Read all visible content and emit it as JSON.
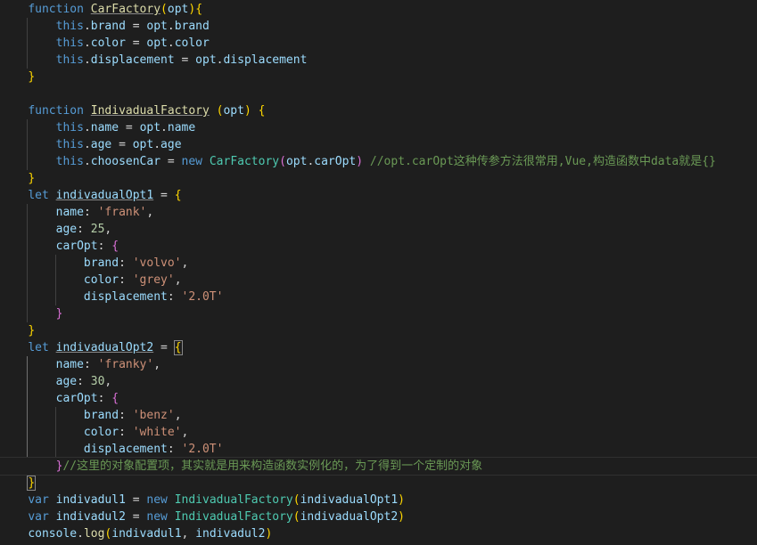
{
  "lines": [
    [
      {
        "t": "    "
      },
      {
        "t": "function",
        "c": "kw"
      },
      {
        "t": " "
      },
      {
        "t": "CarFactory",
        "c": "fn",
        "ul": true
      },
      {
        "t": "(",
        "c": "p1"
      },
      {
        "t": "opt",
        "c": "var"
      },
      {
        "t": ")",
        "c": "p1"
      },
      {
        "t": "{",
        "c": "p1"
      }
    ],
    [
      {
        "t": "        "
      },
      {
        "t": "this",
        "c": "this"
      },
      {
        "t": "."
      },
      {
        "t": "brand",
        "c": "prop"
      },
      {
        "t": " = "
      },
      {
        "t": "opt",
        "c": "var"
      },
      {
        "t": "."
      },
      {
        "t": "brand",
        "c": "prop"
      }
    ],
    [
      {
        "t": "        "
      },
      {
        "t": "this",
        "c": "this"
      },
      {
        "t": "."
      },
      {
        "t": "color",
        "c": "prop"
      },
      {
        "t": " = "
      },
      {
        "t": "opt",
        "c": "var"
      },
      {
        "t": "."
      },
      {
        "t": "color",
        "c": "prop"
      }
    ],
    [
      {
        "t": "        "
      },
      {
        "t": "this",
        "c": "this"
      },
      {
        "t": "."
      },
      {
        "t": "displacement",
        "c": "prop"
      },
      {
        "t": " = "
      },
      {
        "t": "opt",
        "c": "var"
      },
      {
        "t": "."
      },
      {
        "t": "displacement",
        "c": "prop"
      }
    ],
    [
      {
        "t": "    "
      },
      {
        "t": "}",
        "c": "p1"
      }
    ],
    [],
    [
      {
        "t": "    "
      },
      {
        "t": "function",
        "c": "kw"
      },
      {
        "t": " "
      },
      {
        "t": "IndivadualFactory",
        "c": "fn",
        "ul": true
      },
      {
        "t": " "
      },
      {
        "t": "(",
        "c": "p1"
      },
      {
        "t": "opt",
        "c": "var"
      },
      {
        "t": ")",
        "c": "p1"
      },
      {
        "t": " "
      },
      {
        "t": "{",
        "c": "p1"
      }
    ],
    [
      {
        "t": "        "
      },
      {
        "t": "this",
        "c": "this"
      },
      {
        "t": "."
      },
      {
        "t": "name",
        "c": "prop"
      },
      {
        "t": " = "
      },
      {
        "t": "opt",
        "c": "var"
      },
      {
        "t": "."
      },
      {
        "t": "name",
        "c": "prop"
      }
    ],
    [
      {
        "t": "        "
      },
      {
        "t": "this",
        "c": "this"
      },
      {
        "t": "."
      },
      {
        "t": "age",
        "c": "prop"
      },
      {
        "t": " = "
      },
      {
        "t": "opt",
        "c": "var"
      },
      {
        "t": "."
      },
      {
        "t": "age",
        "c": "prop"
      }
    ],
    [
      {
        "t": "        "
      },
      {
        "t": "this",
        "c": "this"
      },
      {
        "t": "."
      },
      {
        "t": "choosenCar",
        "c": "prop"
      },
      {
        "t": " = "
      },
      {
        "t": "new",
        "c": "kw"
      },
      {
        "t": " "
      },
      {
        "t": "CarFactory",
        "c": "cls"
      },
      {
        "t": "(",
        "c": "p2"
      },
      {
        "t": "opt",
        "c": "var"
      },
      {
        "t": "."
      },
      {
        "t": "carOpt",
        "c": "prop"
      },
      {
        "t": ")",
        "c": "p2"
      },
      {
        "t": " "
      },
      {
        "t": "//opt.carOpt这种传参方法很常用,Vue,构造函数中data就是{}",
        "c": "com"
      }
    ],
    [
      {
        "t": "    "
      },
      {
        "t": "}",
        "c": "p1"
      }
    ],
    [
      {
        "t": "    "
      },
      {
        "t": "let",
        "c": "kw"
      },
      {
        "t": " "
      },
      {
        "t": "indivadualOpt1",
        "c": "var",
        "ul": true
      },
      {
        "t": " = "
      },
      {
        "t": "{",
        "c": "p1"
      }
    ],
    [
      {
        "t": "        "
      },
      {
        "t": "name",
        "c": "prop"
      },
      {
        "t": ": "
      },
      {
        "t": "'frank'",
        "c": "str"
      },
      {
        "t": ","
      }
    ],
    [
      {
        "t": "        "
      },
      {
        "t": "age",
        "c": "prop"
      },
      {
        "t": ": "
      },
      {
        "t": "25",
        "c": "num"
      },
      {
        "t": ","
      }
    ],
    [
      {
        "t": "        "
      },
      {
        "t": "carOpt",
        "c": "prop"
      },
      {
        "t": ": "
      },
      {
        "t": "{",
        "c": "p2"
      }
    ],
    [
      {
        "t": "            "
      },
      {
        "t": "brand",
        "c": "prop"
      },
      {
        "t": ": "
      },
      {
        "t": "'volvo'",
        "c": "str"
      },
      {
        "t": ","
      }
    ],
    [
      {
        "t": "            "
      },
      {
        "t": "color",
        "c": "prop"
      },
      {
        "t": ": "
      },
      {
        "t": "'grey'",
        "c": "str"
      },
      {
        "t": ","
      }
    ],
    [
      {
        "t": "            "
      },
      {
        "t": "displacement",
        "c": "prop"
      },
      {
        "t": ": "
      },
      {
        "t": "'2.0T'",
        "c": "str"
      }
    ],
    [
      {
        "t": "        "
      },
      {
        "t": "}",
        "c": "p2"
      }
    ],
    [
      {
        "t": "    "
      },
      {
        "t": "}",
        "c": "p1"
      }
    ],
    [
      {
        "t": "    "
      },
      {
        "t": "let",
        "c": "kw"
      },
      {
        "t": " "
      },
      {
        "t": "indivadualOpt2",
        "c": "var",
        "ul": true
      },
      {
        "t": " = "
      },
      {
        "t": "{",
        "c": "p1",
        "box": true
      }
    ],
    [
      {
        "t": "        "
      },
      {
        "t": "name",
        "c": "prop"
      },
      {
        "t": ": "
      },
      {
        "t": "'franky'",
        "c": "str"
      },
      {
        "t": ","
      }
    ],
    [
      {
        "t": "        "
      },
      {
        "t": "age",
        "c": "prop"
      },
      {
        "t": ": "
      },
      {
        "t": "30",
        "c": "num"
      },
      {
        "t": ","
      }
    ],
    [
      {
        "t": "        "
      },
      {
        "t": "carOpt",
        "c": "prop"
      },
      {
        "t": ": "
      },
      {
        "t": "{",
        "c": "p2"
      }
    ],
    [
      {
        "t": "            "
      },
      {
        "t": "brand",
        "c": "prop"
      },
      {
        "t": ": "
      },
      {
        "t": "'benz'",
        "c": "str"
      },
      {
        "t": ","
      }
    ],
    [
      {
        "t": "            "
      },
      {
        "t": "color",
        "c": "prop"
      },
      {
        "t": ": "
      },
      {
        "t": "'white'",
        "c": "str"
      },
      {
        "t": ","
      }
    ],
    [
      {
        "t": "            "
      },
      {
        "t": "displacement",
        "c": "prop"
      },
      {
        "t": ": "
      },
      {
        "t": "'2.0T'",
        "c": "str"
      }
    ],
    [
      {
        "t": "        "
      },
      {
        "t": "}",
        "c": "p2"
      },
      {
        "t": "//这里的对象配置项，其实就是用来构造函数实例化的，为了得到一个定制的对象",
        "c": "com"
      }
    ],
    [
      {
        "t": "    "
      },
      {
        "t": "}",
        "c": "p1",
        "box": true
      }
    ],
    [
      {
        "t": "    "
      },
      {
        "t": "var",
        "c": "kw"
      },
      {
        "t": " "
      },
      {
        "t": "indivadul1",
        "c": "var"
      },
      {
        "t": " = "
      },
      {
        "t": "new",
        "c": "kw"
      },
      {
        "t": " "
      },
      {
        "t": "IndivadualFactory",
        "c": "cls"
      },
      {
        "t": "(",
        "c": "p1"
      },
      {
        "t": "indivadualOpt1",
        "c": "var"
      },
      {
        "t": ")",
        "c": "p1"
      }
    ],
    [
      {
        "t": "    "
      },
      {
        "t": "var",
        "c": "kw"
      },
      {
        "t": " "
      },
      {
        "t": "indivadul2",
        "c": "var"
      },
      {
        "t": " = "
      },
      {
        "t": "new",
        "c": "kw"
      },
      {
        "t": " "
      },
      {
        "t": "IndivadualFactory",
        "c": "cls"
      },
      {
        "t": "(",
        "c": "p1"
      },
      {
        "t": "indivadualOpt2",
        "c": "var"
      },
      {
        "t": ")",
        "c": "p1"
      }
    ],
    [
      {
        "t": "    "
      },
      {
        "t": "console",
        "c": "var"
      },
      {
        "t": "."
      },
      {
        "t": "log",
        "c": "fn"
      },
      {
        "t": "(",
        "c": "p1"
      },
      {
        "t": "indivadul1",
        "c": "var"
      },
      {
        "t": ", "
      },
      {
        "t": "indivadul2",
        "c": "var"
      },
      {
        "t": ")",
        "c": "p1"
      }
    ]
  ]
}
